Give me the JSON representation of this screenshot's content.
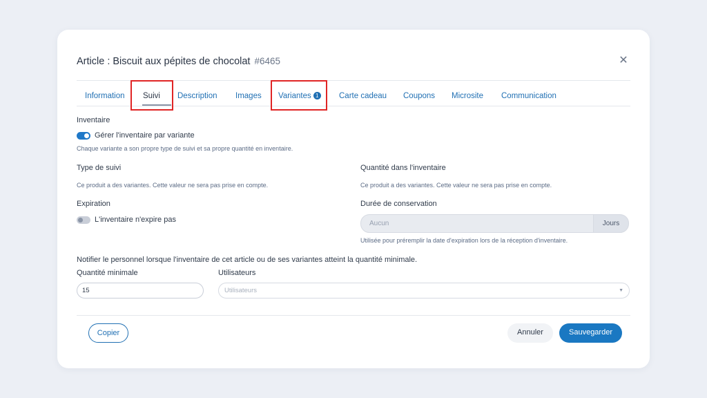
{
  "modal": {
    "title": "Article : Biscuit aux pépites de chocolat",
    "id": "#6465",
    "close_glyph": "✕"
  },
  "tabs": [
    {
      "label": "Information"
    },
    {
      "label": "Suivi",
      "active": true
    },
    {
      "label": "Description"
    },
    {
      "label": "Images"
    },
    {
      "label": "Variantes",
      "badge": "1"
    },
    {
      "label": "Carte cadeau"
    },
    {
      "label": "Coupons"
    },
    {
      "label": "Microsite"
    },
    {
      "label": "Communication"
    }
  ],
  "inventory": {
    "heading": "Inventaire",
    "toggle_label": "Gérer l'inventaire par variante",
    "toggle_on": true,
    "help": "Chaque variante a son propre type de suivi et sa propre quantité en inventaire."
  },
  "tracking": {
    "label": "Type de suivi",
    "note": "Ce produit a des variantes. Cette valeur ne sera pas prise en compte."
  },
  "quantity": {
    "label": "Quantité dans l'inventaire",
    "note": "Ce produit a des variantes. Cette valeur ne sera pas prise en compte."
  },
  "expiration": {
    "label": "Expiration",
    "toggle_label": "L'inventaire n'expire pas",
    "toggle_on": false
  },
  "shelf_life": {
    "label": "Durée de conservation",
    "value": "Aucun",
    "suffix": "Jours",
    "help": "Utilisée pour préremplir la date d'expiration lors de la réception d'inventaire."
  },
  "notify": {
    "text": "Notifier le personnel lorsque l'inventaire de cet article ou de ses variantes atteint la quantité minimale.",
    "min_label": "Quantité minimale",
    "min_value": "15",
    "users_label": "Utilisateurs",
    "users_placeholder": "Utilisateurs"
  },
  "footer": {
    "copy": "Copier",
    "cancel": "Annuler",
    "save": "Sauvegarder"
  },
  "colors": {
    "accent": "#1f6fb3",
    "primary_button": "#1a78c2",
    "highlight": "#e02424"
  }
}
